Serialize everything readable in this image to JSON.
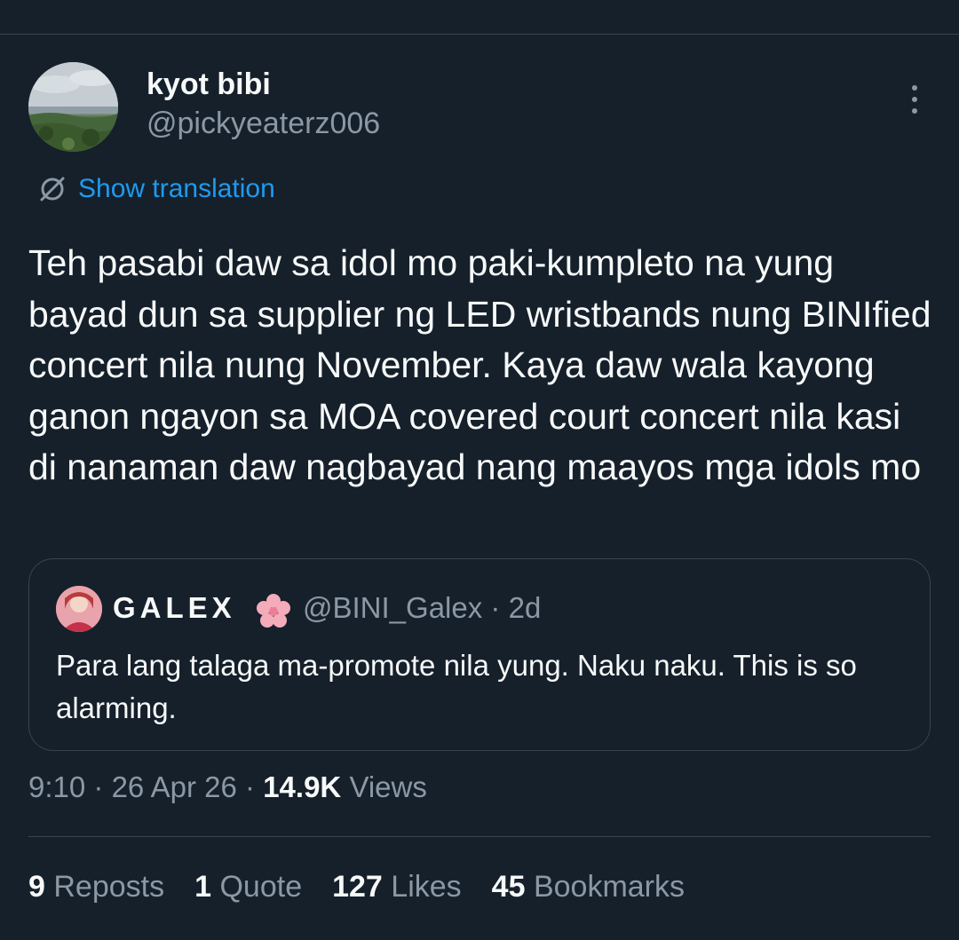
{
  "author": {
    "display_name": "kyot bibi",
    "handle": "@pickyeaterz006"
  },
  "translate": {
    "icon": "globe-slash-icon",
    "label": "Show translation"
  },
  "tweet": {
    "text": "Teh pasabi daw sa idol mo paki-kumpleto na yung bayad dun sa supplier ng LED wristbands nung BINIfied concert nila nung November. Kaya daw wala kayong ganon ngayon sa MOA covered court concert nila kasi di nanaman daw nagbayad nang maayos mga idols mo"
  },
  "quote": {
    "display_name": "GALEX",
    "emoji": "🌸",
    "handle": "@BINI_Galex",
    "separator": "·",
    "age": "2d",
    "text": "Para lang talaga ma-promote nila yung. Naku naku. This is so alarming."
  },
  "meta": {
    "time": "9:10",
    "sep1": "·",
    "date": "26 Apr 26",
    "sep2": "·",
    "views_count": "14.9K",
    "views_label": "Views"
  },
  "stats": {
    "reposts_count": "9",
    "reposts_label": "Reposts",
    "quotes_count": "1",
    "quotes_label": "Quote",
    "likes_count": "127",
    "likes_label": "Likes",
    "bookmarks_count": "45",
    "bookmarks_label": "Bookmarks"
  },
  "colors": {
    "background": "#15202b",
    "primary_text": "#f7f9f9",
    "secondary_text": "#8b98a5",
    "accent": "#1d9bf0",
    "border": "#38444d"
  }
}
